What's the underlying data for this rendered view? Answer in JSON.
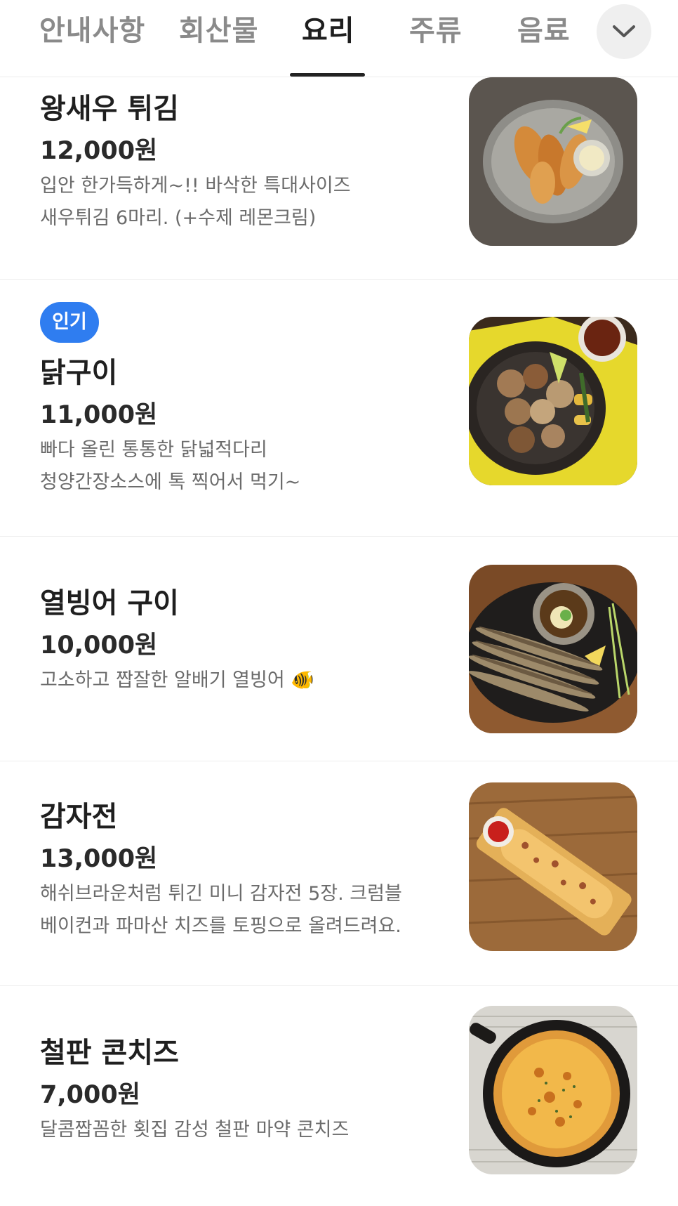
{
  "tabs": [
    {
      "label": "안내사항",
      "active": false
    },
    {
      "label": "회산물",
      "active": false
    },
    {
      "label": "요리",
      "active": true
    },
    {
      "label": "주류",
      "active": false
    },
    {
      "label": "음료",
      "active": false
    }
  ],
  "more_icon": "chevron-down-icon",
  "items": [
    {
      "name": "왕새우 튀김",
      "price": "12,000원",
      "desc": [
        "입안 한가득하게~!! 바삭한 특대사이즈",
        "새우튀김 6마리. (+수제 레몬크림)"
      ],
      "badge": null,
      "image": "fried-shrimp-photo"
    },
    {
      "name": "닭구이",
      "price": "11,000원",
      "desc": [
        "빠다 올린 통통한 닭넓적다리",
        "청양간장소스에 톡 찍어서 먹기~"
      ],
      "badge": "인기",
      "image": "grilled-chicken-photo"
    },
    {
      "name": "열빙어 구이",
      "price": "10,000원",
      "desc": [
        "고소하고 짭잘한 알배기 열빙어 🐠"
      ],
      "badge": null,
      "image": "grilled-smelt-photo"
    },
    {
      "name": "감자전",
      "price": "13,000원",
      "desc": [
        "해쉬브라운처럼 튀긴 미니 감자전 5장. 크럼블",
        "베이컨과 파마산 치즈를 토핑으로 올려드려요."
      ],
      "badge": null,
      "image": "potato-pancake-photo"
    },
    {
      "name": "철판 콘치즈",
      "price": "7,000원",
      "desc": [
        "달콤짭꼼한 횟집 감성 철판 마약 콘치즈"
      ],
      "badge": null,
      "image": "corn-cheese-photo"
    }
  ],
  "colors": {
    "badge": "#2f7df0",
    "active_tab": "#1e1e1e",
    "inactive_tab": "#8a8a8a",
    "description": "#6b6b6b"
  }
}
